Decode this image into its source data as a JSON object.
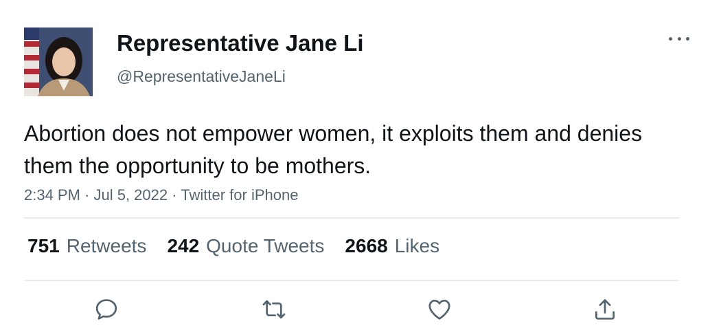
{
  "user": {
    "display_name": "Representative Jane Li",
    "handle": "@RepresentativeJaneLi",
    "avatar_icon": "profile-photo"
  },
  "tweet": {
    "text": "Abortion does not empower women, it exploits them and denies them the opportunity to be mothers.",
    "meta": "2:34 PM · Jul 5, 2022 · Twitter for iPhone"
  },
  "stats": [
    {
      "count": "751",
      "label": "Retweets"
    },
    {
      "count": "242",
      "label": "Quote Tweets"
    },
    {
      "count": "2668",
      "label": "Likes"
    }
  ],
  "actions": {
    "reply_icon": "reply-icon",
    "retweet_icon": "retweet-icon",
    "like_icon": "like-icon",
    "share_icon": "share-icon"
  },
  "colors": {
    "text_primary": "#0f1419",
    "text_secondary": "#536471",
    "divider": "#e6ecf0",
    "icon": "#536471"
  }
}
